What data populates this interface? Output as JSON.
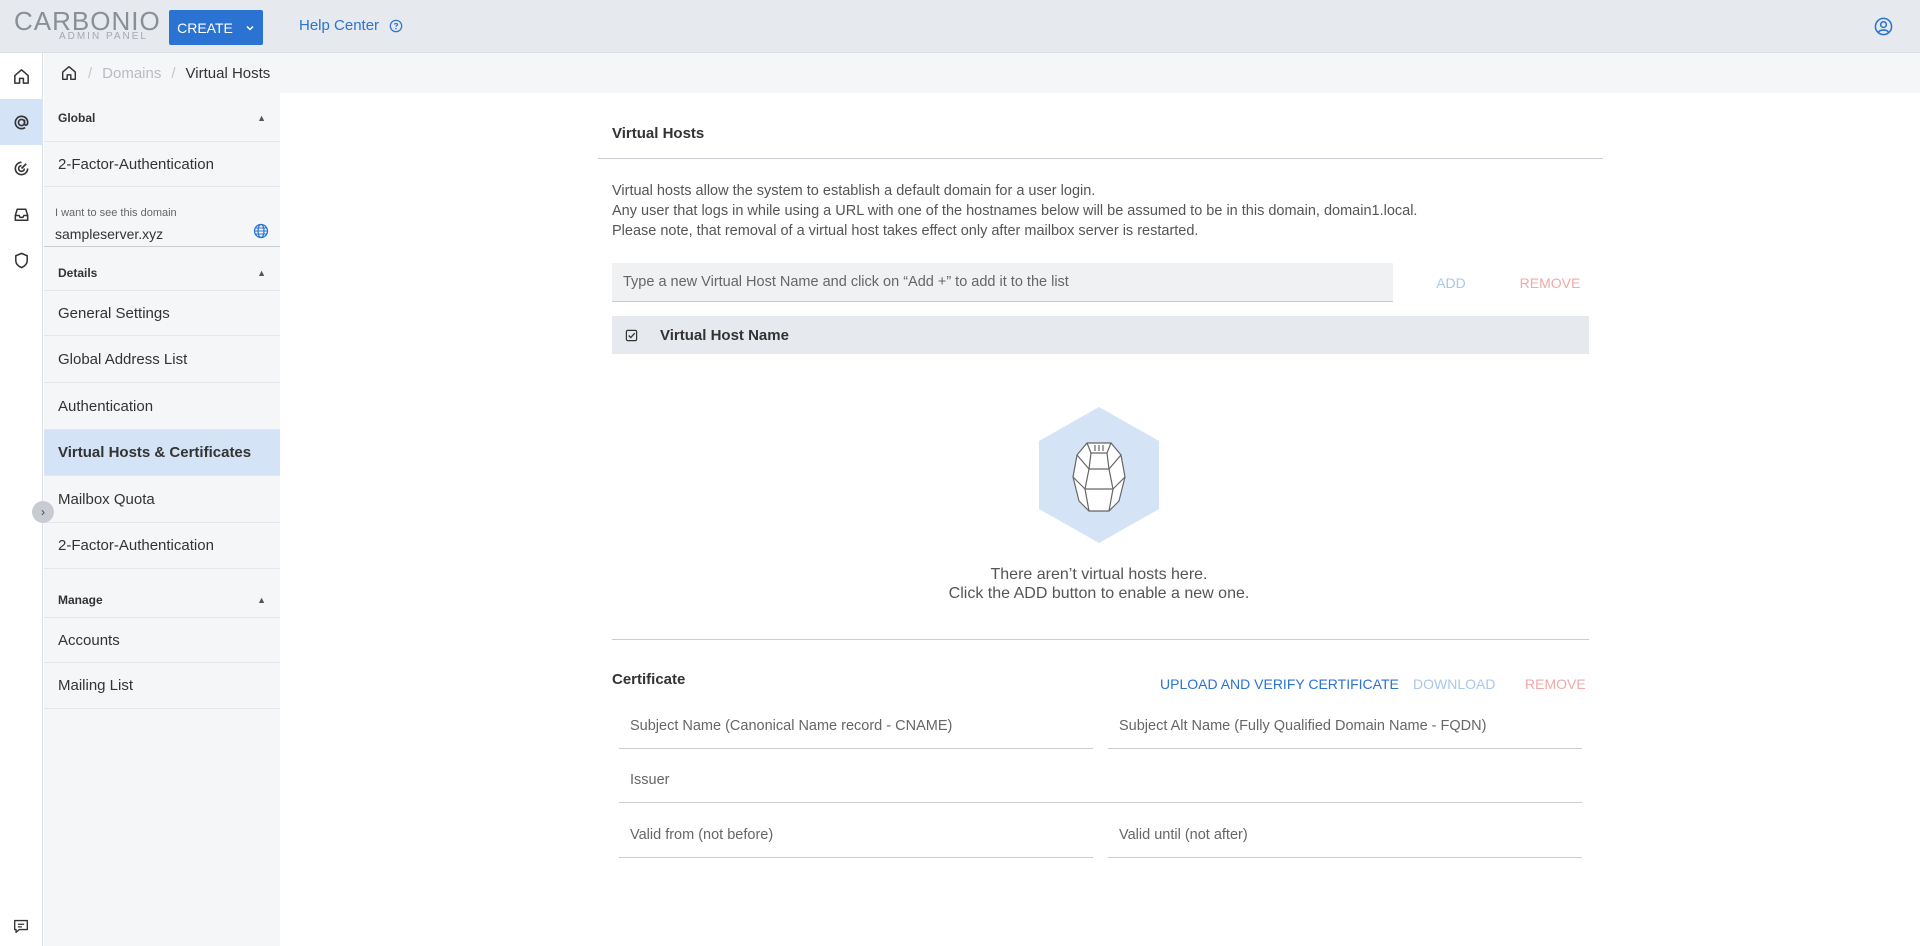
{
  "header": {
    "logo_main": "CARBONIO",
    "logo_sub": "ADMIN PANEL",
    "create_label": "CREATE",
    "help_label": "Help Center"
  },
  "breadcrumb": {
    "domains": "Domains",
    "current": "Virtual Hosts",
    "separator": "/"
  },
  "sidebar": {
    "global_label": "Global",
    "global_items": [
      "2-Factor-Authentication"
    ],
    "domain_label": "I want to see this domain",
    "domain_value": "sampleserver.xyz",
    "details_label": "Details",
    "details_items": [
      "General Settings",
      "Global Address List",
      "Authentication",
      "Virtual Hosts & Certificates",
      "Mailbox Quota",
      "2-Factor-Authentication"
    ],
    "manage_label": "Manage",
    "manage_items": [
      "Accounts",
      "Mailing List"
    ]
  },
  "virtual_hosts": {
    "title": "Virtual Hosts",
    "desc_line1": "Virtual hosts allow the system to establish a default domain for a user login.",
    "desc_line2": "Any user that logs in while using a URL with one of the hostnames below will be assumed to be in this domain, domain1.local.",
    "desc_line3": "Please note, that removal of a virtual host takes effect only after mailbox server is restarted.",
    "input_placeholder": "Type a new Virtual Host Name and click on “Add +” to add it to the list",
    "add_label": "ADD",
    "remove_label": "REMOVE",
    "column_header": "Virtual Host Name",
    "empty_line1": "There aren’t virtual hosts here.",
    "empty_line2": "Click the ADD button to enable a new one."
  },
  "certificate": {
    "title": "Certificate",
    "upload_label": "UPLOAD AND VERIFY CERTIFICATE",
    "download_label": "DOWNLOAD",
    "remove_label": "REMOVE",
    "subject_name": "Subject Name (Canonical Name record - CNAME)",
    "subject_alt_name": "Subject Alt Name (Fully Qualified Domain Name - FQDN)",
    "issuer": "Issuer",
    "valid_from": "Valid from (not before)",
    "valid_until": "Valid until (not after)"
  },
  "colors": {
    "primary": "#2b73d2",
    "disabled_primary": "#a8c7ee",
    "disabled_danger": "#f0a8a8",
    "active_bg": "#d5e3f6"
  },
  "icons": {
    "rail": [
      "home-icon",
      "at-icon",
      "gauge-icon",
      "inbox-icon",
      "shield-icon"
    ],
    "other": [
      "user-circle-icon",
      "help-circle-icon",
      "globe-icon",
      "chat-icon",
      "check-square-icon"
    ]
  }
}
